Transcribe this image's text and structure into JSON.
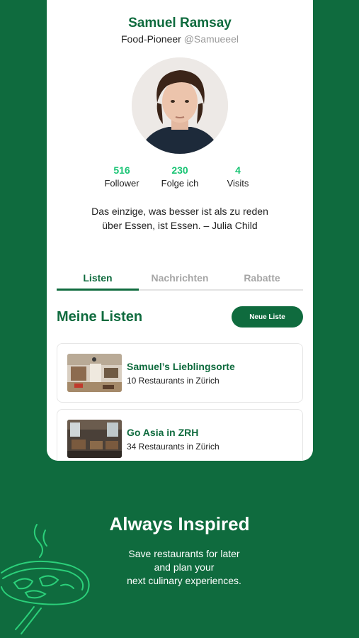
{
  "profile": {
    "name": "Samuel Ramsay",
    "role": "Food-Pioneer",
    "handle": "@Samueeel"
  },
  "stats": [
    {
      "value": "516",
      "label": "Follower"
    },
    {
      "value": "230",
      "label": "Folge ich"
    },
    {
      "value": "4",
      "label": "Visits"
    }
  ],
  "quote": {
    "line1": "Das einzige, was besser ist als zu reden",
    "line2": "über Essen, ist Essen. – Julia Child"
  },
  "tabs": [
    {
      "label": "Listen",
      "active": true
    },
    {
      "label": "Nachrichten",
      "active": false
    },
    {
      "label": "Rabatte",
      "active": false
    }
  ],
  "lists": {
    "title": "Meine Listen",
    "new_button": "Neue Liste",
    "items": [
      {
        "title": "Samuel’s Lieblingsorte",
        "subtitle": "10 Restaurants in Zürich"
      },
      {
        "title": "Go Asia in ZRH",
        "subtitle": "34 Restaurants in Zürich"
      }
    ]
  },
  "promo": {
    "headline": "Always Inspired",
    "line1": "Save restaurants for later",
    "line2": "and plan your",
    "line3": "next culinary experiences."
  },
  "colors": {
    "brand_green": "#0f6b3e",
    "accent_green": "#19c474",
    "background": "#0f6b3e",
    "card": "#ffffff"
  }
}
